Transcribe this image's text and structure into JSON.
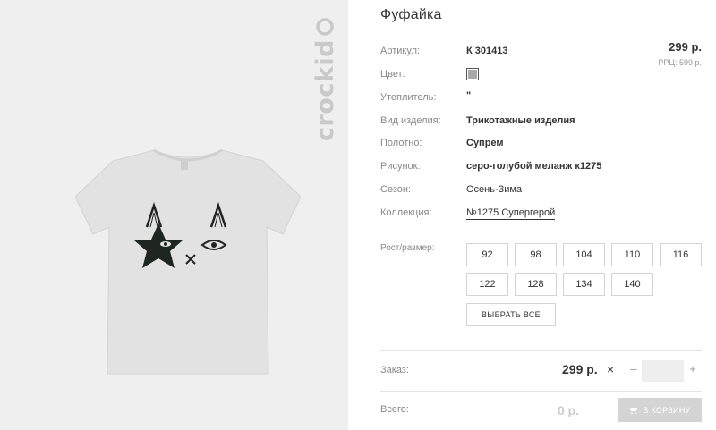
{
  "product": {
    "title": "Фуфайка",
    "brand_logo": "crockid",
    "image_icon": "tshirt-image"
  },
  "price": {
    "main": "299 р.",
    "rrc": "РРЦ: 599 р."
  },
  "attributes": [
    {
      "label": "Артикул:",
      "value": "К 301413"
    },
    {
      "label": "Цвет:",
      "value": ""
    },
    {
      "label": "Утеплитель:",
      "value": "\""
    },
    {
      "label": "Вид изделия:",
      "value": "Трикотажные изделия"
    },
    {
      "label": "Полотно:",
      "value": "Супрем"
    },
    {
      "label": "Рисунок:",
      "value": "серо-голубой меланж к1275"
    },
    {
      "label": "Сезон:",
      "value": "Осень-Зима"
    },
    {
      "label": "Коллекция:",
      "value": "№1275 Супергерой"
    }
  ],
  "color_swatch": "#a8a8a8",
  "sizes": {
    "label": "Рост/размер:",
    "options": [
      "92",
      "98",
      "104",
      "110",
      "116",
      "122",
      "128",
      "134",
      "140"
    ],
    "select_all": "ВЫБРАТЬ ВСЕ"
  },
  "order": {
    "label": "Заказ:",
    "price": "299 р.",
    "times": "×",
    "minus": "–",
    "plus": "+",
    "quantity": ""
  },
  "total": {
    "label": "Всего:",
    "price": "0 р.",
    "cart_button": "В КОРЗИНУ",
    "cart_icon": "cart-icon"
  }
}
